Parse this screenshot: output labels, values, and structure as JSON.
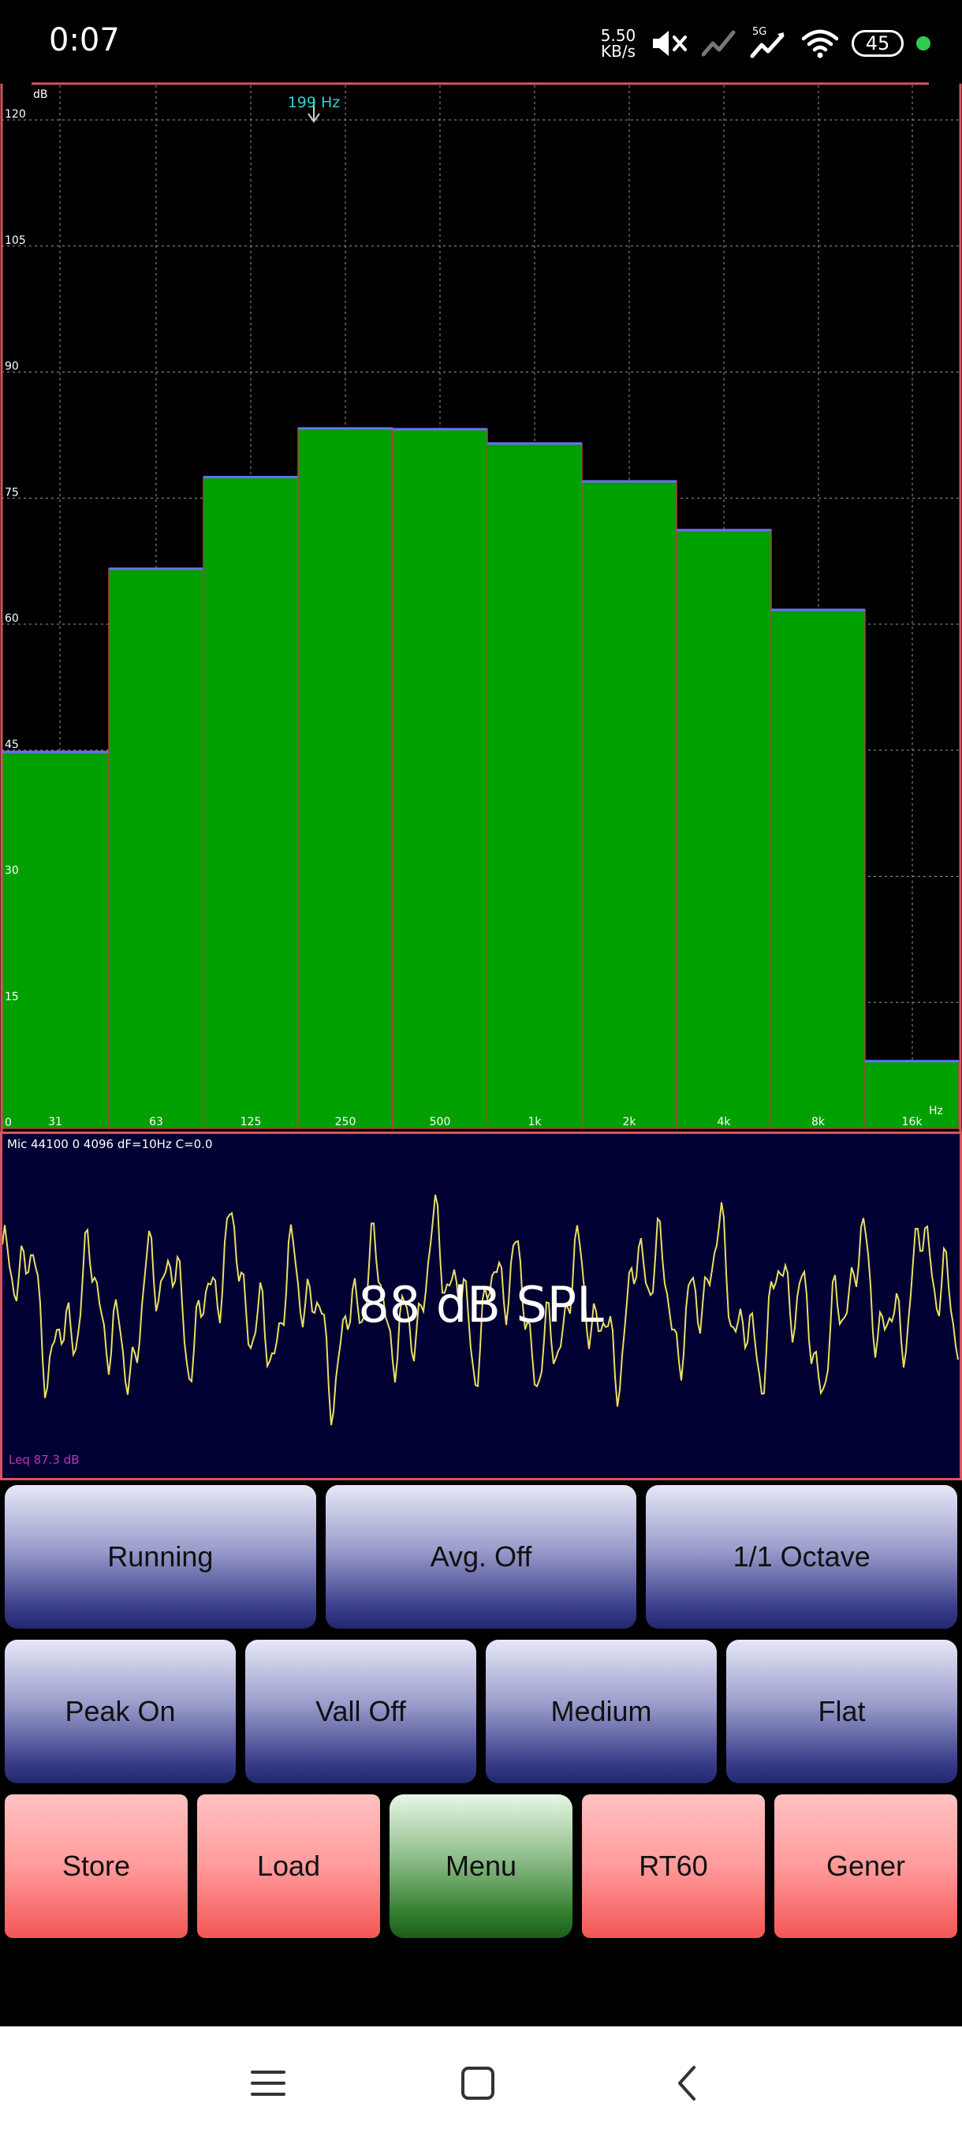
{
  "status_bar": {
    "time": "0:07",
    "net_speed_value": "5.50",
    "net_speed_unit": "KB/s",
    "network_type": "5G",
    "battery": "45",
    "icons": [
      "mute-icon",
      "signal-icon",
      "signal-5g-icon",
      "wifi-icon",
      "battery-icon",
      "privacy-dot-icon"
    ]
  },
  "spectrum": {
    "marker": "199 Hz",
    "y_unit": "dB",
    "x_unit": "Hz"
  },
  "chart_data": {
    "type": "bar",
    "categories": [
      "31",
      "63",
      "125",
      "250",
      "500",
      "1k",
      "2k",
      "4k",
      "8k",
      "16k"
    ],
    "values": [
      44.8,
      66.6,
      77.5,
      83.3,
      83.2,
      81.5,
      77.0,
      71.2,
      61.7,
      8.0
    ],
    "yticks": [
      0,
      15,
      30,
      45,
      60,
      75,
      90,
      105,
      120
    ],
    "ylim": [
      0,
      120
    ],
    "ylabel": "dB",
    "xlabel": "Hz",
    "grid": true,
    "bar_color": "#00a000",
    "peak_color": "#6f6fff",
    "frame_color": "#d9535d"
  },
  "scope": {
    "mic_info": "Mic 44100 0 4096 dF=10Hz C=0.0",
    "readout": "88 dB SPL",
    "leq": "Leq  87.3 dB",
    "trace_color": "#e8e060"
  },
  "buttons": {
    "row1": [
      "Running",
      "Avg. Off",
      "1/1 Octave"
    ],
    "row2": [
      "Peak On",
      "Vall Off",
      "Medium",
      "Flat"
    ],
    "row3": [
      "Store",
      "Load",
      "Menu",
      "RT60",
      "Gener"
    ]
  },
  "nav": {
    "icons": [
      "menu-icon",
      "home-icon",
      "back-icon"
    ]
  }
}
